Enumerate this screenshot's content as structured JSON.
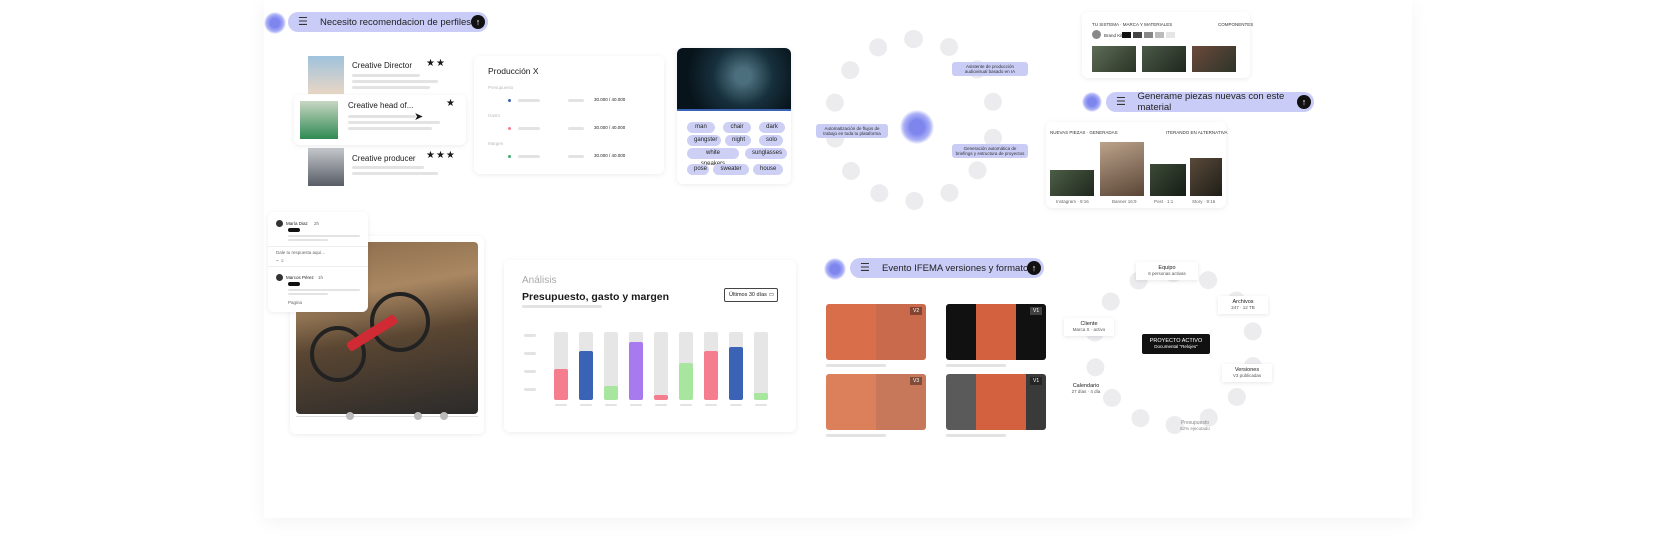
{
  "prompts": {
    "profiles": "Necesito recomendacion de perfiles",
    "generate": "Generame piezas nuevas con este material",
    "event": "Evento IFEMA versiones y formatos"
  },
  "profiles": [
    {
      "title": "Creative Director",
      "stars": "★★"
    },
    {
      "title": "Creative head of...",
      "stars": "★"
    },
    {
      "title": "Creative producer",
      "stars": "★★★"
    }
  ],
  "production": {
    "title": "Producción X",
    "rows": [
      "Presupuesto",
      "Gasto",
      "Margen"
    ],
    "values": [
      "30.000 / 40.000",
      "30.000 / 40.000",
      "30.000 / 40.000"
    ]
  },
  "tags": [
    "man",
    "chair",
    "dark",
    "gangster",
    "night",
    "solo",
    "white sneakers",
    "sunglasses",
    "pose",
    "sweater",
    "house"
  ],
  "graph_nodes": {
    "left": "Automatización de flujos de trabajo en toda tu plataforma",
    "top": "Asistente de producción audiovisual basado en IA",
    "bottom": "Generación automática de briefings y estructura de proyectos"
  },
  "brand_panel": {
    "title": "TU SISTEMA · MARCA Y MATERIALES",
    "right": "COMPONENTES",
    "brand": "Brand Kit",
    "colors": [
      "#111111",
      "#444444",
      "#888888",
      "#bbbbbb",
      "#e5e5e5"
    ]
  },
  "generated": {
    "left": "NUEVAS PIEZAS · GENERADAS",
    "right": "ITERANDO EN ALTERNATIVA",
    "labels": [
      "Instagram · 9:16",
      "Banner 16:9",
      "Post · 1:1",
      "Story · 9:16"
    ]
  },
  "comments": [
    {
      "name": "María Diaz",
      "time": "2h"
    },
    {
      "name": "Marcos Pérez",
      "time": "1h"
    }
  ],
  "comment_hint": "Dale tu respuesta aquí...",
  "comment_reply": "Pagina",
  "analysis": {
    "eyebrow": "Análisis",
    "title": "Presupuesto, gasto y margen",
    "range": "Últimos 30 días",
    "bars": [
      {
        "fill": 0.45,
        "color": "#f47d8e"
      },
      {
        "fill": 0.72,
        "color": "#3b63b5"
      },
      {
        "fill": 0.2,
        "color": "#a8e6a0"
      },
      {
        "fill": 0.85,
        "color": "#a77af0"
      },
      {
        "fill": 0.08,
        "color": "#f47d8e"
      },
      {
        "fill": 0.55,
        "color": "#a8e6a0"
      },
      {
        "fill": 0.72,
        "color": "#f47d8e"
      },
      {
        "fill": 0.78,
        "color": "#3b63b5"
      },
      {
        "fill": 0.1,
        "color": "#a8e6a0"
      }
    ]
  },
  "versions": [
    "V2",
    "V1",
    "V3",
    "V1"
  ],
  "project_map": {
    "center_title": "PROYECTO ACTIVO",
    "center_sub": "Documental \"Relojes\"",
    "equipo": {
      "title": "Equipo",
      "sub": "6 personas activas"
    },
    "archivos": {
      "title": "Archivos",
      "sub": "247 · 12 TB"
    },
    "cliente": {
      "title": "Cliente",
      "sub": "Marca X · activo"
    },
    "versiones": {
      "title": "Versiones",
      "sub": "V3 publicadas"
    },
    "calendario": {
      "title": "Calendario",
      "sub": "27 días · 4 día"
    },
    "presupuesto": {
      "title": "Presupuesto",
      "sub": "62% ejecutado"
    }
  },
  "colors": {
    "accent": "#c9ccf6",
    "blob": "#7e86ee",
    "dark": "#111111"
  }
}
